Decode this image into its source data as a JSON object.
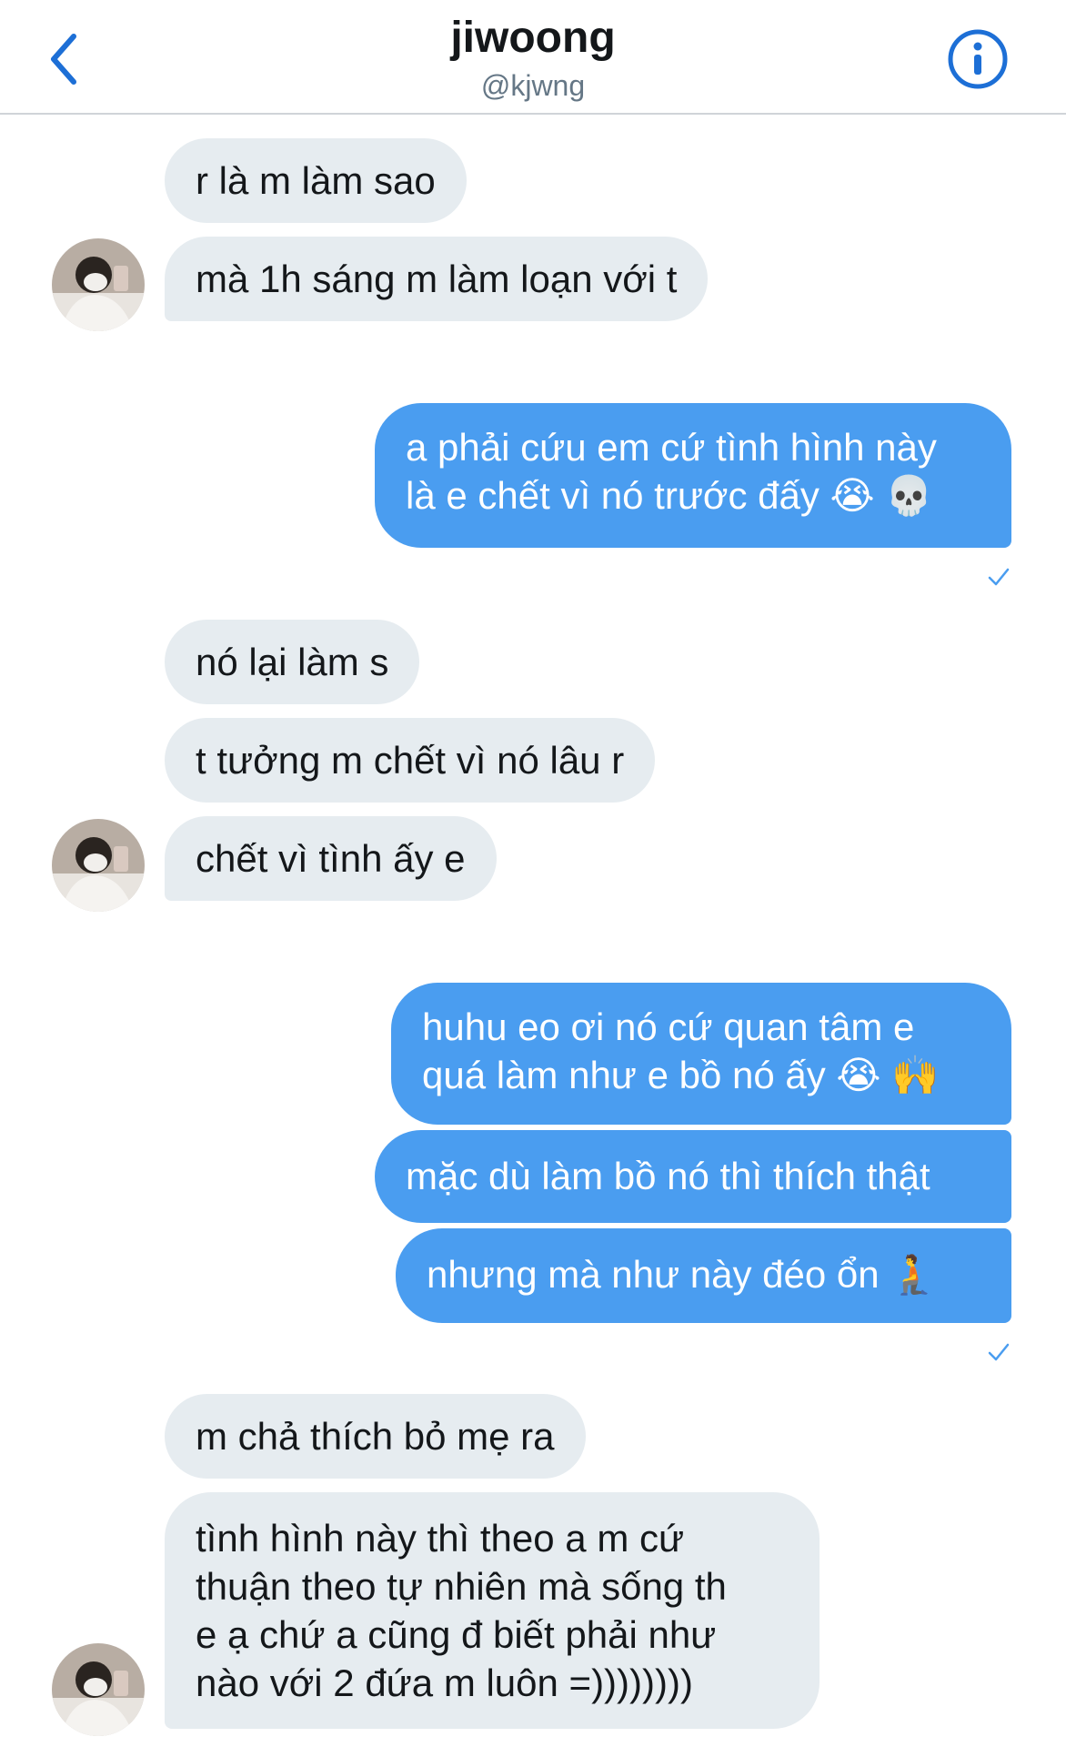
{
  "header": {
    "name": "jiwoong",
    "handle": "@kjwng"
  },
  "messages": [
    {
      "sender": "them",
      "text": "r là m làm sao"
    },
    {
      "sender": "them",
      "text": "mà 1h sáng m làm loạn với t"
    },
    {
      "sender": "me",
      "lines": [
        "a phải cứu em cứ tình hình này",
        "là e chết vì nó trước đấy 😭 💀"
      ]
    },
    {
      "sender": "them",
      "text": "nó lại làm s"
    },
    {
      "sender": "them",
      "text": "t tưởng m chết vì nó lâu r"
    },
    {
      "sender": "them",
      "text": "chết vì tình ấy e"
    },
    {
      "sender": "me",
      "lines": [
        "huhu eo ơi nó cứ quan tâm e",
        "quá làm như e bồ nó ấy 😭 🙌"
      ]
    },
    {
      "sender": "me",
      "text": "mặc dù làm bồ nó thì thích thật"
    },
    {
      "sender": "me",
      "text": "nhưng mà như này đéo ổn 🧎"
    },
    {
      "sender": "them",
      "text": "m chả thích bỏ mẹ ra"
    },
    {
      "sender": "them",
      "lines": [
        "tình hình này thì theo a m cứ",
        "thuận theo tự nhiên mà sống th",
        "e ạ chứ a cũng đ biết phải như",
        "nào với 2 đứa m luôn =))))))))"
      ]
    }
  ],
  "colors": {
    "outgoing": "#4a9df0",
    "incoming": "#e6ecf0",
    "accent": "#1d6fd6"
  },
  "icons": {
    "back": "chevron-left-icon",
    "info": "info-icon",
    "read": "check-icon"
  }
}
